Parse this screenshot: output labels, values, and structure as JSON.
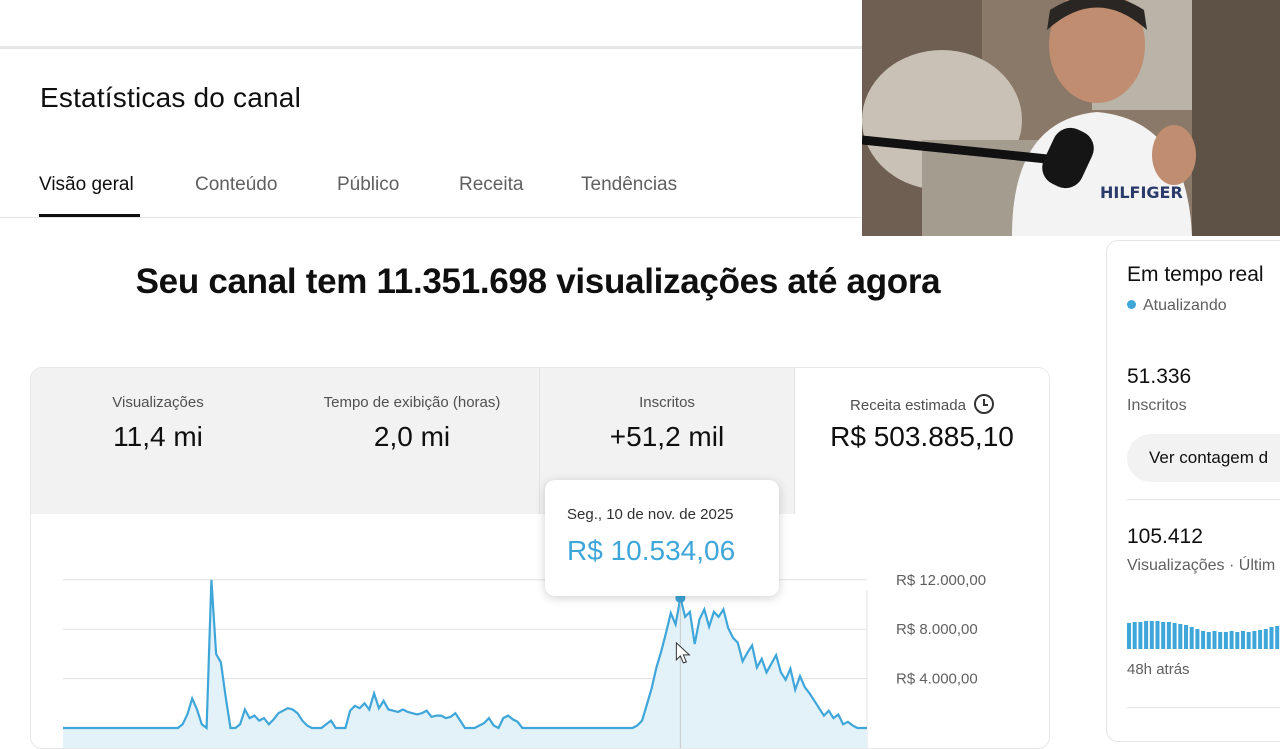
{
  "page": {
    "title": "Estatísticas do canal"
  },
  "tabs": [
    {
      "label": "Visão geral"
    },
    {
      "label": "Conteúdo"
    },
    {
      "label": "Público"
    },
    {
      "label": "Receita"
    },
    {
      "label": "Tendências"
    }
  ],
  "headline": "Seu canal tem 11.351.698 visualizações até agora",
  "metrics": [
    {
      "label": "Visualizações",
      "value": "11,4 mi"
    },
    {
      "label": "Tempo de exibição (horas)",
      "value": "2,0 mi"
    },
    {
      "label": "Inscritos",
      "value": "+51,2 mil"
    },
    {
      "label": "Receita estimada",
      "value": "R$ 503.885,10"
    }
  ],
  "tooltip": {
    "date": "Seg., 10 de nov. de 2025",
    "value": "R$ 10.534,06"
  },
  "realtime": {
    "title": "Em tempo real",
    "status": "Atualizando",
    "subscribers_value": "51.336",
    "subscribers_label": "Inscritos",
    "button_label": "Ver contagem d",
    "views_value": "105.412",
    "views_label": "Visualizações · Últim",
    "bars_caption": "48h atrás"
  },
  "colors": {
    "accent": "#3ea6d8",
    "area_fill": "#e3f1f9"
  },
  "chart_data": {
    "type": "area",
    "y_ticks": [
      "R$ 12.000,00",
      "R$ 8.000,00",
      "R$ 4.000,00"
    ],
    "ylim": [
      0,
      13200
    ],
    "series": [
      {
        "values": [
          0,
          0,
          0,
          0,
          0,
          0,
          0,
          0,
          0,
          0,
          0,
          0,
          0,
          0,
          0,
          0,
          0,
          0,
          0,
          0,
          0,
          0,
          0,
          0,
          0,
          300,
          1100,
          2400,
          1500,
          300,
          0,
          12000,
          6000,
          5300,
          2500,
          0,
          0,
          300,
          1500,
          800,
          1000,
          600,
          800,
          300,
          700,
          1200,
          1400,
          1600,
          1500,
          1200,
          600,
          200,
          0,
          0,
          0,
          300,
          600,
          0,
          0,
          0,
          1400,
          1800,
          1600,
          2000,
          1500,
          2800,
          1600,
          2200,
          1500,
          1400,
          1300,
          1500,
          1300,
          1200,
          1100,
          1200,
          1400,
          900,
          1000,
          1000,
          800,
          900,
          1200,
          600,
          0,
          0,
          0,
          200,
          400,
          800,
          200,
          0,
          800,
          1000,
          700,
          500,
          0,
          0,
          0,
          0,
          0,
          0,
          0,
          0,
          0,
          0,
          0,
          0,
          0,
          0,
          0,
          0,
          0,
          0,
          0,
          0,
          0,
          0,
          0,
          0,
          200,
          600,
          1900,
          3200,
          4900,
          6200,
          7700,
          9300,
          8400,
          10534,
          9000,
          9400,
          6800,
          8800,
          9600,
          8200,
          9400,
          9000,
          9600,
          8100,
          7300,
          6900,
          5400,
          6100,
          6700,
          4900,
          5600,
          4500,
          5200,
          5900,
          4500,
          3900,
          4800,
          3100,
          4200,
          3300,
          2800,
          2200,
          1600,
          1000,
          1400,
          800,
          1100,
          300,
          500,
          200,
          0,
          0,
          0
        ]
      }
    ],
    "highlight_value": 10534.06
  }
}
